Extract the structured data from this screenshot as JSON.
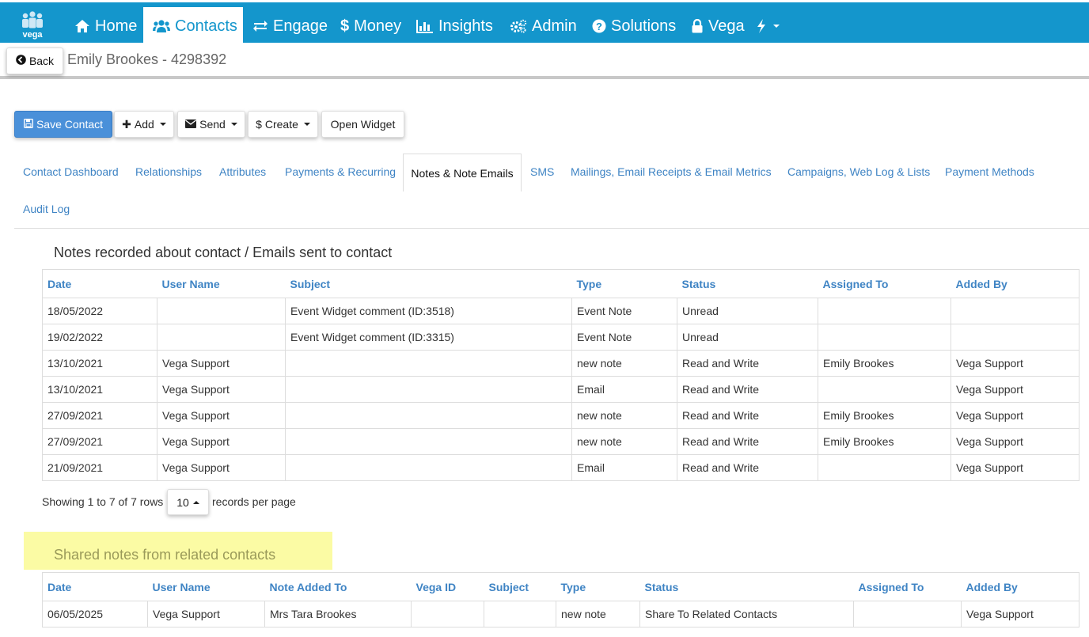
{
  "brand": {
    "logo_text": "vega",
    "primary_color": "#1496cc",
    "button_color": "#4a90d9",
    "link_color": "#3f84c4"
  },
  "nav": {
    "items": [
      {
        "label": "Home",
        "icon": "home-icon"
      },
      {
        "label": "Contacts",
        "icon": "users-icon",
        "active": true
      },
      {
        "label": "Engage",
        "icon": "exchange-icon"
      },
      {
        "label": "Money",
        "icon": "dollar-icon"
      },
      {
        "label": "Insights",
        "icon": "bar-chart-icon"
      },
      {
        "label": "Admin",
        "icon": "cogs-icon"
      },
      {
        "label": "Solutions",
        "icon": "question-circle-icon"
      },
      {
        "label": "Vega",
        "icon": "lock-icon"
      }
    ],
    "extra_icon": "bolt-icon"
  },
  "header": {
    "back_label": "Back",
    "contact_title": "Emily Brookes - 4298392"
  },
  "toolbar": {
    "save_label": "Save Contact",
    "add_label": "Add",
    "send_label": "Send",
    "create_label": "Create",
    "widget_label": "Open Widget"
  },
  "tabs": [
    "Contact Dashboard",
    "Relationships",
    "Attributes",
    "Payments & Recurring",
    "Notes & Note Emails",
    "SMS",
    "Mailings, Email Receipts & Email Metrics",
    "Campaigns, Web Log & Lists",
    "Payment Methods",
    "Audit Log"
  ],
  "notes": {
    "title": "Notes recorded about contact / Emails sent to contact",
    "columns": [
      "Date",
      "User Name",
      "Subject",
      "Type",
      "Status",
      "Assigned To",
      "Added By"
    ],
    "rows": [
      [
        "18/05/2022",
        "",
        "Event Widget comment (ID:3518)",
        "Event Note",
        "Unread",
        "",
        ""
      ],
      [
        "19/02/2022",
        "",
        "Event Widget comment (ID:3315)",
        "Event Note",
        "Unread",
        "",
        ""
      ],
      [
        "13/10/2021",
        "Vega Support",
        "",
        "new note",
        "Read and Write",
        "Emily Brookes",
        "Vega Support"
      ],
      [
        "13/10/2021",
        "Vega Support",
        "",
        "Email",
        "Read and Write",
        "",
        "Vega Support"
      ],
      [
        "27/09/2021",
        "Vega Support",
        "",
        "new note",
        "Read and Write",
        "Emily Brookes",
        "Vega Support"
      ],
      [
        "27/09/2021",
        "Vega Support",
        "",
        "new note",
        "Read and Write",
        "Emily Brookes",
        "Vega Support"
      ],
      [
        "21/09/2021",
        "Vega Support",
        "",
        "Email",
        "Read and Write",
        "",
        "Vega Support"
      ]
    ]
  },
  "pager": {
    "showing": "Showing 1 to 7 of 7 rows",
    "page_size": "10",
    "per_page_label": "records per page"
  },
  "shared": {
    "title": "Shared notes from related contacts",
    "columns": [
      "Date",
      "User Name",
      "Note Added To",
      "Vega ID",
      "Subject",
      "Type",
      "Status",
      "Assigned To",
      "Added By"
    ],
    "rows": [
      [
        "06/05/2025",
        "Vega Support",
        "Mrs Tara Brookes",
        "",
        "",
        "new note",
        "Share To Related Contacts",
        "",
        "Vega Support"
      ]
    ]
  }
}
